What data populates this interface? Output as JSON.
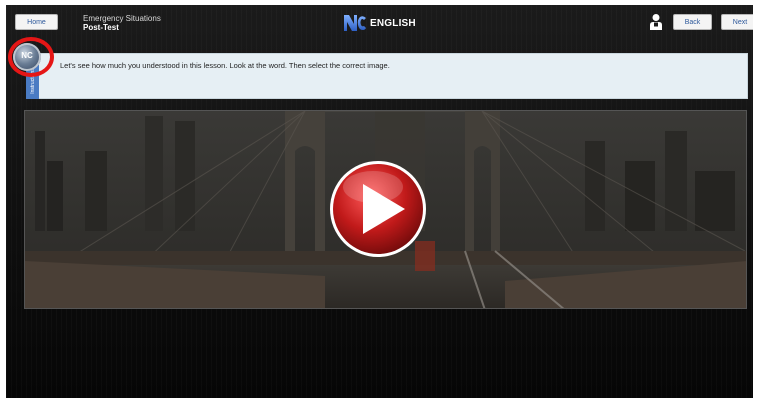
{
  "header": {
    "home_label": "Home",
    "course_title": "Emergency Situations",
    "section": "Post-Test",
    "logo_word": "ENGLISH",
    "back_label": "Back",
    "next_label": "Next"
  },
  "instructions": {
    "tab_label": "Instructions",
    "text": "Let's see how much you understood in this lesson. Look at the word. Then select the correct image."
  },
  "badge": {
    "logo_text": "NC"
  },
  "icons": {
    "user": "user-icon",
    "play": "play-icon",
    "logo": "nc-logo-icon"
  },
  "colors": {
    "accent_red": "#e51616",
    "play_red": "#c11a1a",
    "tab_blue": "#4a7bc3",
    "instruction_bg": "#e6eff4",
    "logo_blue": "#3f6fd0"
  }
}
